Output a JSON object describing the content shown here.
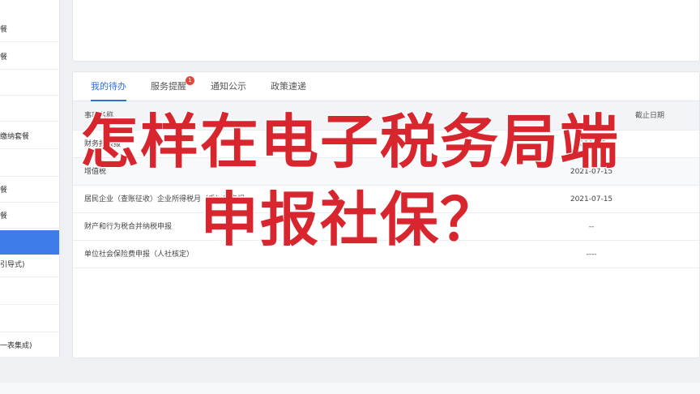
{
  "sidebar": {
    "items": [
      {
        "label": "餐",
        "name": "sidebar-item-1"
      },
      {
        "label": "餐",
        "name": "sidebar-item-2"
      },
      {
        "label": "",
        "name": "sidebar-item-3"
      },
      {
        "label": "",
        "name": "sidebar-item-4"
      },
      {
        "label": "缴纳套餐",
        "name": "sidebar-item-5"
      },
      {
        "label": "",
        "name": "sidebar-item-6"
      },
      {
        "label": "餐",
        "name": "sidebar-item-7"
      },
      {
        "label": "餐",
        "name": "sidebar-item-8"
      },
      {
        "label": "",
        "name": "sidebar-item-9-active"
      },
      {
        "label": "引导式)",
        "name": "sidebar-item-10"
      },
      {
        "label": "",
        "name": "sidebar-item-11"
      },
      {
        "label": "",
        "name": "sidebar-item-12"
      },
      {
        "label": "一表集成)",
        "name": "sidebar-item-13"
      }
    ]
  },
  "tabs": {
    "todo": "我的待办",
    "service": "服务提醒",
    "service_badge": "1",
    "notice": "通知公示",
    "policy": "政策速递"
  },
  "table": {
    "headers": {
      "name": "事项名称",
      "date": "截止日期"
    },
    "rows": [
      {
        "name": "财务报表报",
        "date": "2021-07-"
      },
      {
        "name": "增值税",
        "date": "2021-07-15"
      },
      {
        "name": "居民企业（查账征收）企业所得税月（季）度申报",
        "date": "2021-07-15"
      },
      {
        "name": "财产和行为税合并纳税申报",
        "date": "--"
      },
      {
        "name": "单位社会保险费申报（人社核定）",
        "date": "----"
      }
    ]
  },
  "overlay": {
    "line1": "怎样在电子税务局端",
    "line2": "申报社保？"
  },
  "colors": {
    "accent": "#2e6fd8",
    "active_sidebar": "#3e7de8",
    "overlay_text": "#d8262f",
    "badge": "#e8443a"
  }
}
